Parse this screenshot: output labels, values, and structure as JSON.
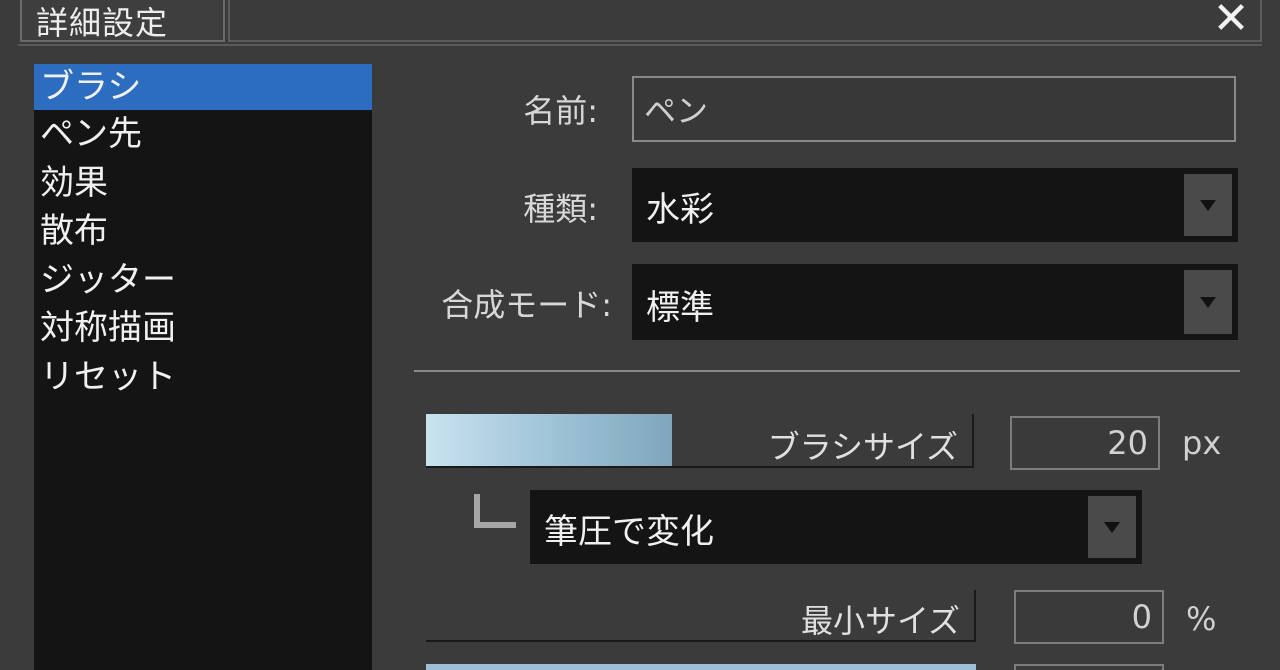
{
  "window": {
    "title": "詳細設定",
    "close_icon": "close-icon"
  },
  "sidebar": {
    "items": [
      {
        "label": "ブラシ",
        "selected": true
      },
      {
        "label": "ペン先",
        "selected": false
      },
      {
        "label": "効果",
        "selected": false
      },
      {
        "label": "散布",
        "selected": false
      },
      {
        "label": "ジッター",
        "selected": false
      },
      {
        "label": "対称描画",
        "selected": false
      },
      {
        "label": "リセット",
        "selected": false
      }
    ]
  },
  "form": {
    "name_label": "名前:",
    "name_value": "ペン",
    "type_label": "種類:",
    "type_value": "水彩",
    "blend_label": "合成モード:",
    "blend_value": "標準"
  },
  "brush_size": {
    "label": "ブラシサイズ",
    "value": "20",
    "unit": "px",
    "fill_fraction": 0.45,
    "pressure_value": "筆圧で変化"
  },
  "min_size": {
    "label": "最小サイズ",
    "value": "0",
    "unit": "%",
    "fill_fraction": 0
  },
  "colors": {
    "selection": "#2d6dbf",
    "slider_fill": "#9cc1d6",
    "panel_bg": "#3b3b3b",
    "list_bg": "#141414"
  }
}
